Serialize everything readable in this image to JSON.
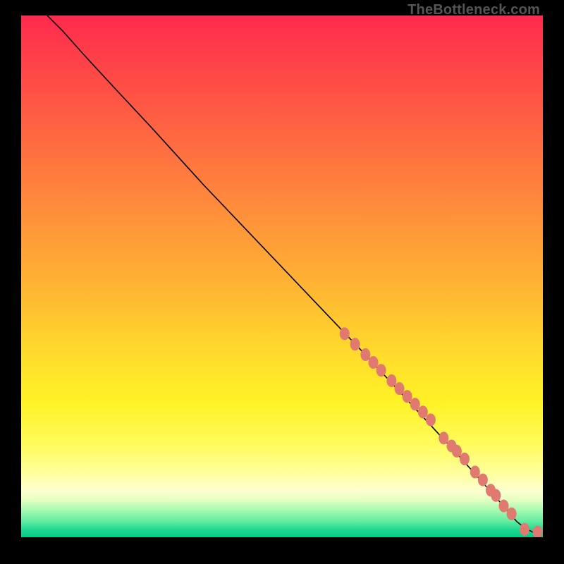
{
  "attribution": "TheBottleneck.com",
  "colors": {
    "marker": "#e07a70",
    "curve": "#000000",
    "background_top": "#ff2a4d",
    "background_bottom": "#00cc88",
    "page": "#000000"
  },
  "chart_data": {
    "type": "line",
    "title": "",
    "xlabel": "",
    "ylabel": "",
    "xlim": [
      0,
      100
    ],
    "ylim": [
      0,
      100
    ],
    "grid": false,
    "legend": false,
    "series": [
      {
        "name": "curve",
        "kind": "line",
        "x": [
          5,
          8,
          12,
          18,
          25,
          35,
          45,
          55,
          65,
          72,
          78,
          84,
          88,
          92,
          95,
          96.5,
          98,
          99
        ],
        "y": [
          100,
          97,
          92.5,
          86,
          78.5,
          67.5,
          57,
          46.5,
          36,
          28.5,
          22,
          15.5,
          11,
          6.5,
          3,
          1.8,
          1,
          1
        ]
      },
      {
        "name": "markers",
        "kind": "scatter",
        "x": [
          62,
          64,
          66,
          67.5,
          69,
          71,
          72.5,
          74,
          75.5,
          77,
          78.5,
          81,
          82.5,
          83.5,
          85,
          87,
          88.5,
          90,
          91,
          92.5,
          94,
          96.5,
          99
        ],
        "y": [
          39,
          37,
          35,
          33.5,
          32,
          30,
          28.5,
          27,
          25.5,
          24,
          22.5,
          19,
          17.5,
          16.5,
          15,
          12.5,
          11,
          9,
          8,
          6,
          4.5,
          1.5,
          1
        ]
      }
    ]
  }
}
